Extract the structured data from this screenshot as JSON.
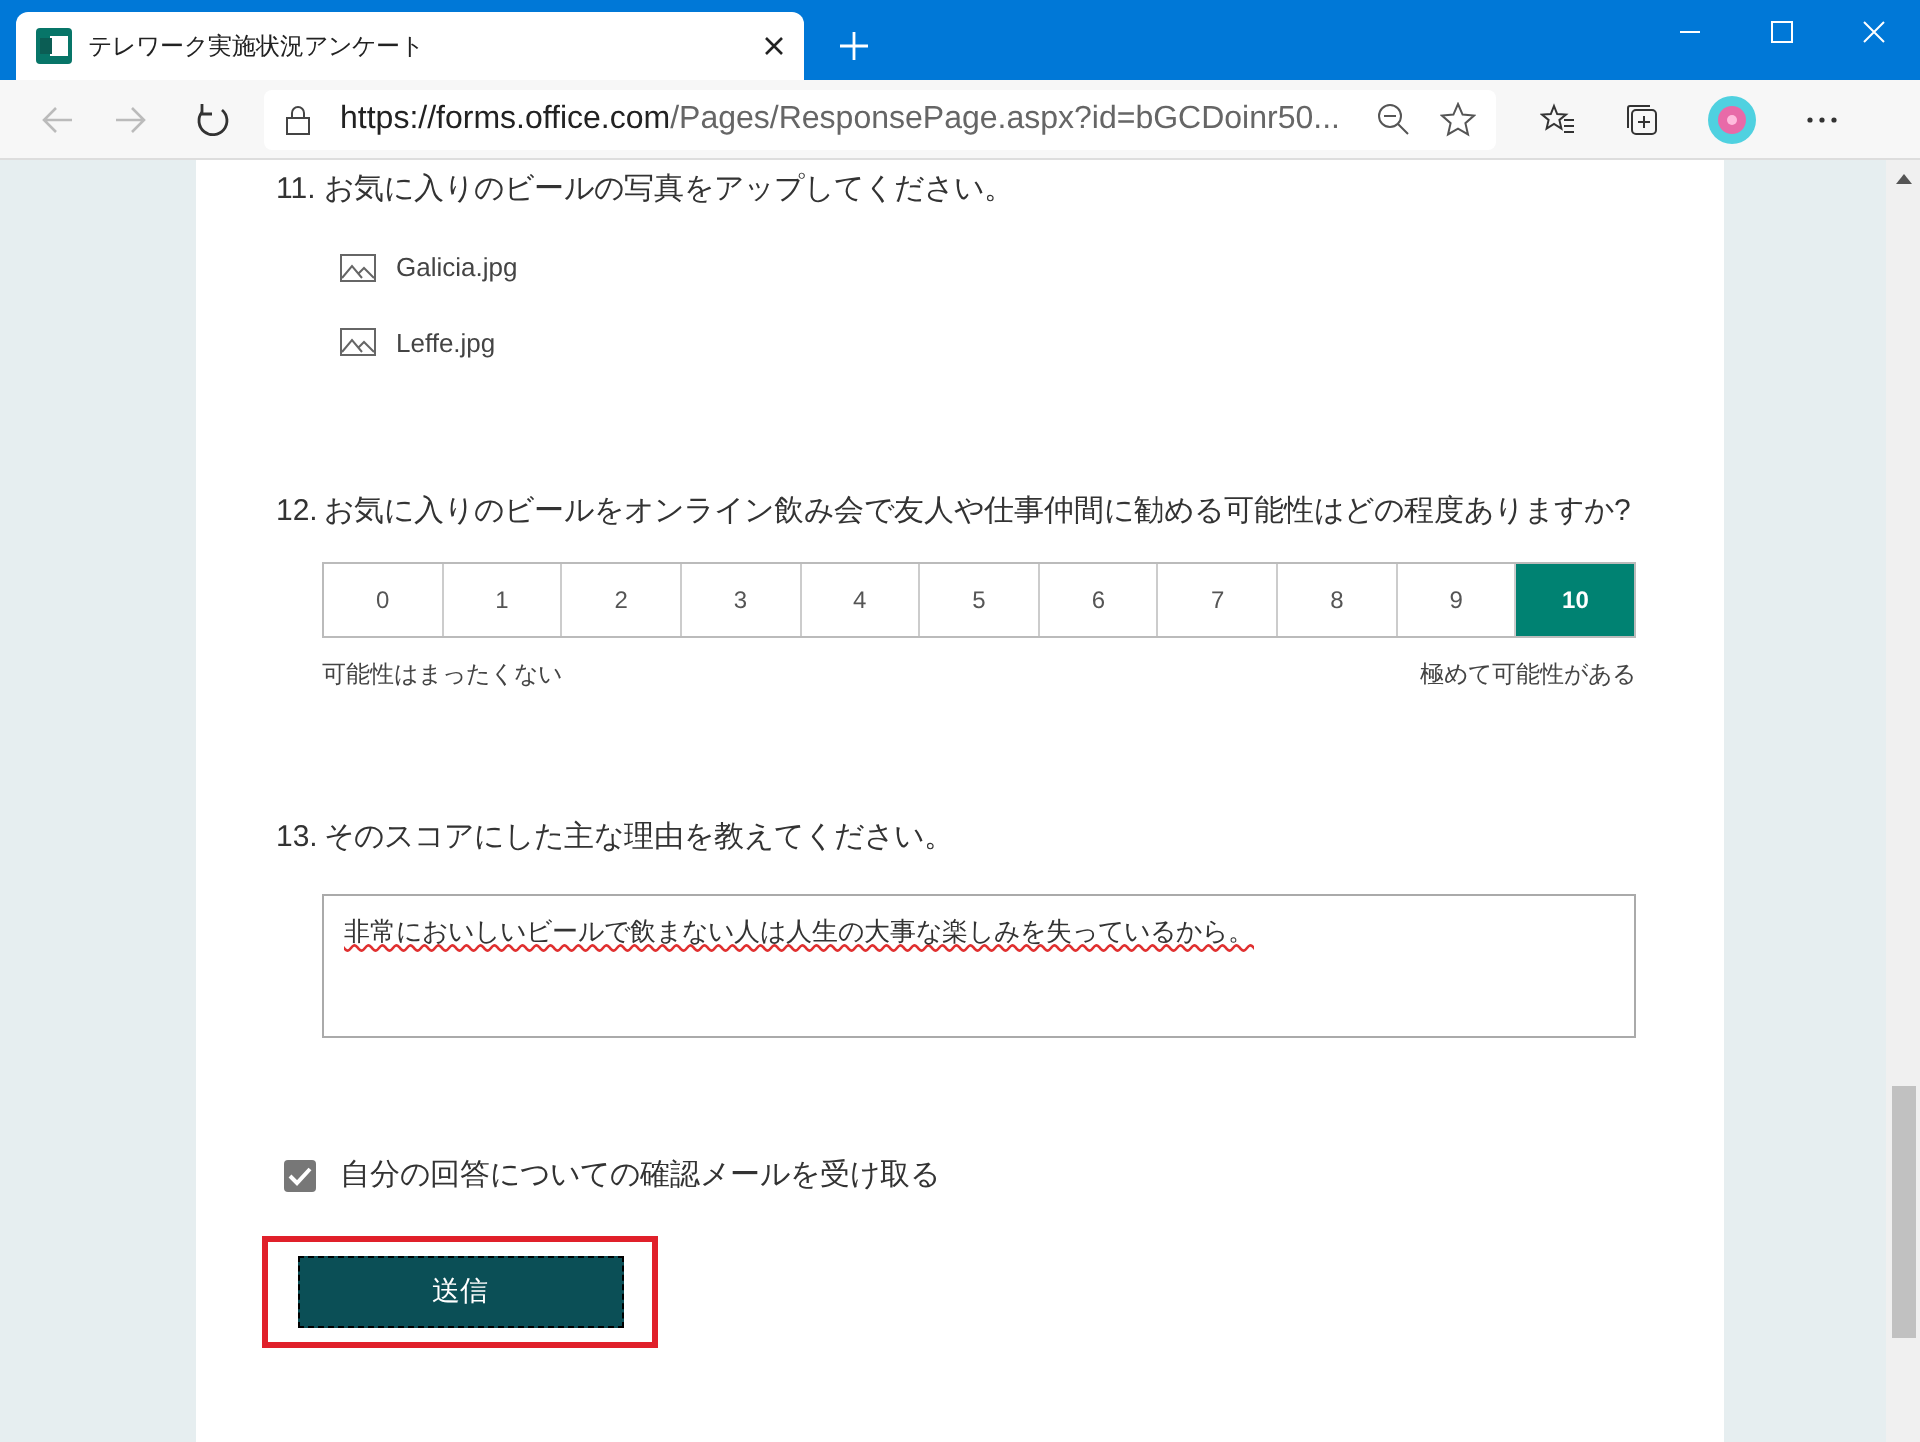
{
  "browser": {
    "tab_title": "テレワーク実施状況アンケート",
    "url_host": "https://forms.office.com",
    "url_rest": "/Pages/ResponsePage.aspx?id=bGCDoinr50..."
  },
  "questions": [
    {
      "kind": "files",
      "number": "11.",
      "text": "お気に入りのビールの写真をアップしてください。",
      "files": [
        "Galicia.jpg",
        "Leffe.jpg"
      ]
    },
    {
      "kind": "rating",
      "number": "12.",
      "text": "お気に入りのビールをオンライン飲み会で友人や仕事仲間に勧める可能性はどの程度ありますか?",
      "options": [
        {
          "label": "0",
          "selected": false
        },
        {
          "label": "1",
          "selected": false
        },
        {
          "label": "2",
          "selected": false
        },
        {
          "label": "3",
          "selected": false
        },
        {
          "label": "4",
          "selected": false
        },
        {
          "label": "5",
          "selected": false
        },
        {
          "label": "6",
          "selected": false
        },
        {
          "label": "7",
          "selected": false
        },
        {
          "label": "8",
          "selected": false
        },
        {
          "label": "9",
          "selected": false
        },
        {
          "label": "10",
          "selected": true
        }
      ],
      "low_label": "可能性はまったくない",
      "high_label": "極めて可能性がある"
    },
    {
      "kind": "text",
      "number": "13.",
      "text": "そのスコアにした主な理由を教えてください。",
      "value": "非常においしいビールで飲まない人は人生の大事な楽しみを失っているから。"
    }
  ],
  "confirm": {
    "label": "自分の回答についての確認メールを受け取る",
    "checked": true
  },
  "submit": {
    "label": "送信"
  }
}
